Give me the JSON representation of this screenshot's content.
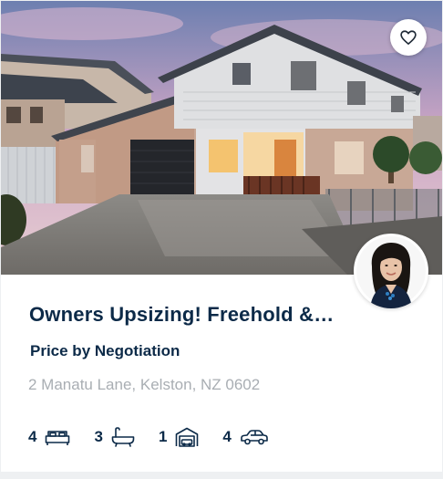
{
  "listing": {
    "title": "Owners Upsizing! Freehold & Brand New",
    "price": "Price by Negotiation",
    "address": "2 Manatu Lane, Kelston, NZ 0602"
  },
  "features": {
    "bedrooms": "4",
    "bathrooms": "3",
    "garages": "1",
    "carparks": "4"
  },
  "icons": {
    "favorite": "heart-outline-icon",
    "bedrooms": "bed-icon",
    "bathrooms": "bathtub-icon",
    "garages": "garage-icon",
    "carparks": "car-icon"
  },
  "colors": {
    "title": "#0c2a48",
    "address": "#a9aeb3",
    "card_bg": "#ffffff"
  }
}
